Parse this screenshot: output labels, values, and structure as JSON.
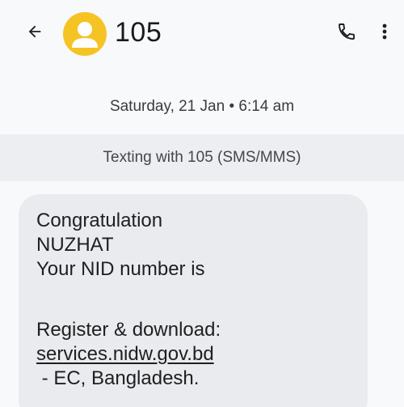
{
  "header": {
    "back_icon": "arrow-left-icon",
    "avatar_icon": "person-avatar-icon",
    "avatar_color": "#f6c325",
    "title": "105",
    "call_icon": "phone-icon",
    "more_icon": "more-vert-icon"
  },
  "conversation": {
    "date_time": "Saturday, 21 Jan • 6:14 am",
    "texting_banner": "Texting with 105 (SMS/MMS)"
  },
  "message": {
    "line1": "Congratulation",
    "line2": "NUZHAT",
    "line3": "Your NID number is",
    "line4": "Register & download:",
    "link": "services.nidw.gov.bd",
    "line5": " - EC, Bangladesh."
  }
}
